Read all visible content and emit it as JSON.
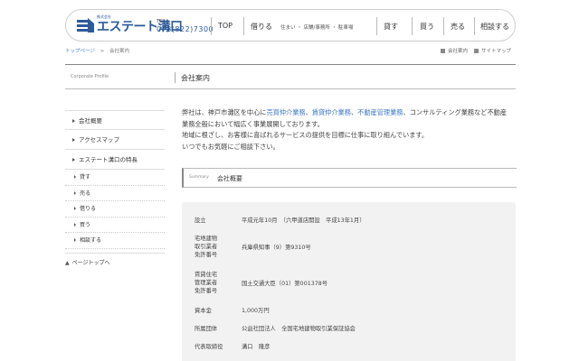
{
  "header": {
    "logo_sub": "株式会社",
    "logo_text": "エステート溝口",
    "tel_label": "TEL",
    "tel": "078(822)7300",
    "nav": [
      {
        "label": "TOP"
      },
      {
        "label": "借りる"
      },
      {
        "label": "住まい ・ 店舗/事務所 ・ 駐車場"
      },
      {
        "label": "貸す"
      },
      {
        "label": "買う"
      },
      {
        "label": "売る"
      },
      {
        "label": "相談する"
      }
    ]
  },
  "breadcrumb": {
    "home": "トップページ",
    "sep": ">",
    "current": "会社案内"
  },
  "util_links": {
    "company": "会社案内",
    "sitemap": "サイトマップ"
  },
  "title": {
    "en": "Corporate Profile",
    "ja": "会社案内"
  },
  "sidebar": {
    "items": [
      {
        "label": "会社概要"
      },
      {
        "label": "アクセスマップ"
      },
      {
        "label": "エステート溝口の特長"
      }
    ],
    "sub_items": [
      {
        "label": "貸す"
      },
      {
        "label": "売る"
      },
      {
        "label": "借りる"
      },
      {
        "label": "買う"
      },
      {
        "label": "相談する"
      }
    ],
    "page_top": "ページトップへ"
  },
  "intro": {
    "p1_a": "弊社は、神戸市灘区を中心に",
    "link1": "売買仲介業務",
    "p1_b": "、",
    "link2": "賃貸仲介業務",
    "p1_c": "、",
    "link3": "不動産管理業務",
    "p1_d": "、コンサルティング業務など不動産",
    "p2": "業務全般において幅広く事業展開しております。",
    "p3": "地域に根ざし、お客様に喜ばれるサービスの提供を目標に仕事に取り組んでいます。",
    "p4": "いつでもお気軽にご相談下さい。"
  },
  "summary": {
    "en": "Summary",
    "ja": "会社概要",
    "rows": [
      {
        "key": "設立",
        "value": "平成元年10月　（六甲道店開設　平成13年1月）"
      },
      {
        "key": "宅地建物\n取引業者\n免許番号",
        "value": "兵庫県知事（9）第9310号"
      },
      {
        "key": "賃貸住宅\n管理業者\n免許番号",
        "value": "国土交通大臣（01）第001378号"
      },
      {
        "key": "資本金",
        "value": "1,000万円"
      },
      {
        "key": "所属団体",
        "value": "公益社団法人　全国宅地建物取引業保証協会"
      },
      {
        "key": "代表取締役",
        "value": "溝口　隆彦"
      }
    ]
  },
  "colors": {
    "brand": "#2c5a9c",
    "link": "#3f79c9"
  }
}
